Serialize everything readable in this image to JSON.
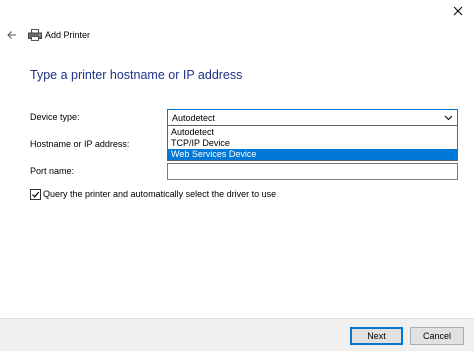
{
  "window": {
    "close_icon": "close-icon"
  },
  "header": {
    "back_icon": "back-arrow-icon",
    "printer_icon": "printer-icon",
    "title": "Add Printer"
  },
  "main": {
    "heading": "Type a printer hostname or IP address",
    "device_type": {
      "label": "Device type:",
      "value": "Autodetect",
      "options": [
        "Autodetect",
        "TCP/IP Device",
        "Web Services Device"
      ],
      "highlighted_option": "Web Services Device"
    },
    "hostname": {
      "label": "Hostname or IP address:",
      "value": ""
    },
    "port_name": {
      "label": "Port name:",
      "value": ""
    },
    "query_checkbox": {
      "label": "Query the printer and automatically select the driver to use",
      "checked": true
    }
  },
  "footer": {
    "next_label": "Next",
    "cancel_label": "Cancel"
  },
  "colors": {
    "accent": "#0078d7",
    "heading": "#1e3287",
    "footer_bg": "#f0f0f0"
  }
}
